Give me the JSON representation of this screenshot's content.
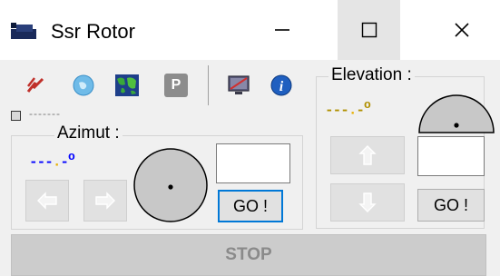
{
  "window": {
    "title": "Ssr Rotor",
    "minimize_label": "Minimize",
    "maximize_label": "Maximize",
    "close_label": "Close"
  },
  "toolbar": {
    "icons": [
      "lightning-icon",
      "globe-icon",
      "world-map-icon",
      "p-icon",
      "screen-icon",
      "info-icon"
    ],
    "p_label": "P"
  },
  "status": {
    "text": "-------"
  },
  "azimut": {
    "label": "Azimut :",
    "reading_dashes": "---",
    "reading_dot": ".",
    "reading_tail": "-",
    "reading_degree": "o",
    "reading_color": "#0000ff",
    "input_value": "",
    "go_label": "GO !"
  },
  "elevation": {
    "label": "Elevation :",
    "reading_dashes": "---",
    "reading_dot": ".",
    "reading_tail": "-",
    "reading_degree": "o",
    "reading_color": "#b09000",
    "input_value": "",
    "go_label": "GO !"
  },
  "stop_label": "STOP",
  "colors": {
    "reading_dot": "#e8b000",
    "dial_fill": "#c8c8c8",
    "focus": "#0078d7"
  }
}
